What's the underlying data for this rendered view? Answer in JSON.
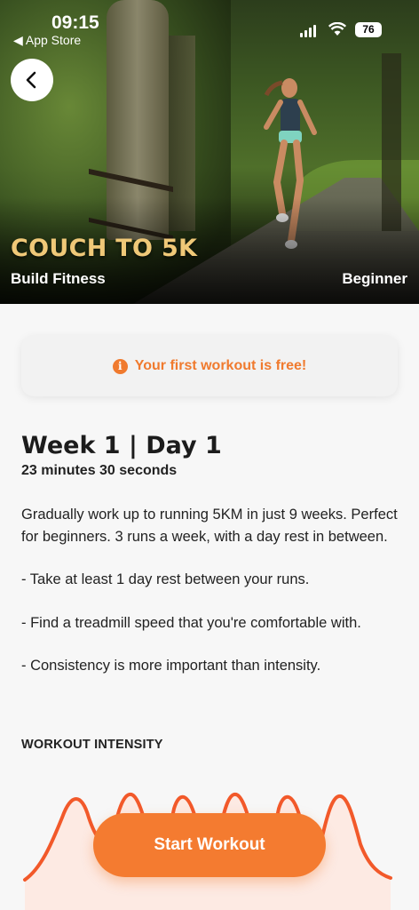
{
  "status_bar": {
    "time": "09:15",
    "back_app": "◀ App Store",
    "battery": "76"
  },
  "hero": {
    "title": "COUCH TO 5K",
    "category": "Build Fitness",
    "level": "Beginner",
    "back_icon": "chevron-left-icon"
  },
  "notice": {
    "icon": "info-icon",
    "icon_glyph": "i",
    "text": "Your first workout is free!"
  },
  "workout": {
    "title": "Week 1 | Day 1",
    "duration": "23 minutes 30 seconds",
    "description": [
      "Gradually work up to running 5KM in just 9 weeks. Perfect for beginners. 3 runs a week, with a day rest in between.",
      "- Take at least 1 day rest between your runs.",
      "- Find a treadmill speed that you're comfortable with.",
      "- Consistency is more important than intensity."
    ],
    "intensity_label": "WORKOUT INTENSITY"
  },
  "intensity_chart": {
    "peaks": 6,
    "color": "#f2592a"
  },
  "cta": {
    "label": "Start Workout",
    "color": "#f47b30"
  },
  "colors": {
    "accent": "#f07a2e",
    "hero_title": "#efc878"
  }
}
